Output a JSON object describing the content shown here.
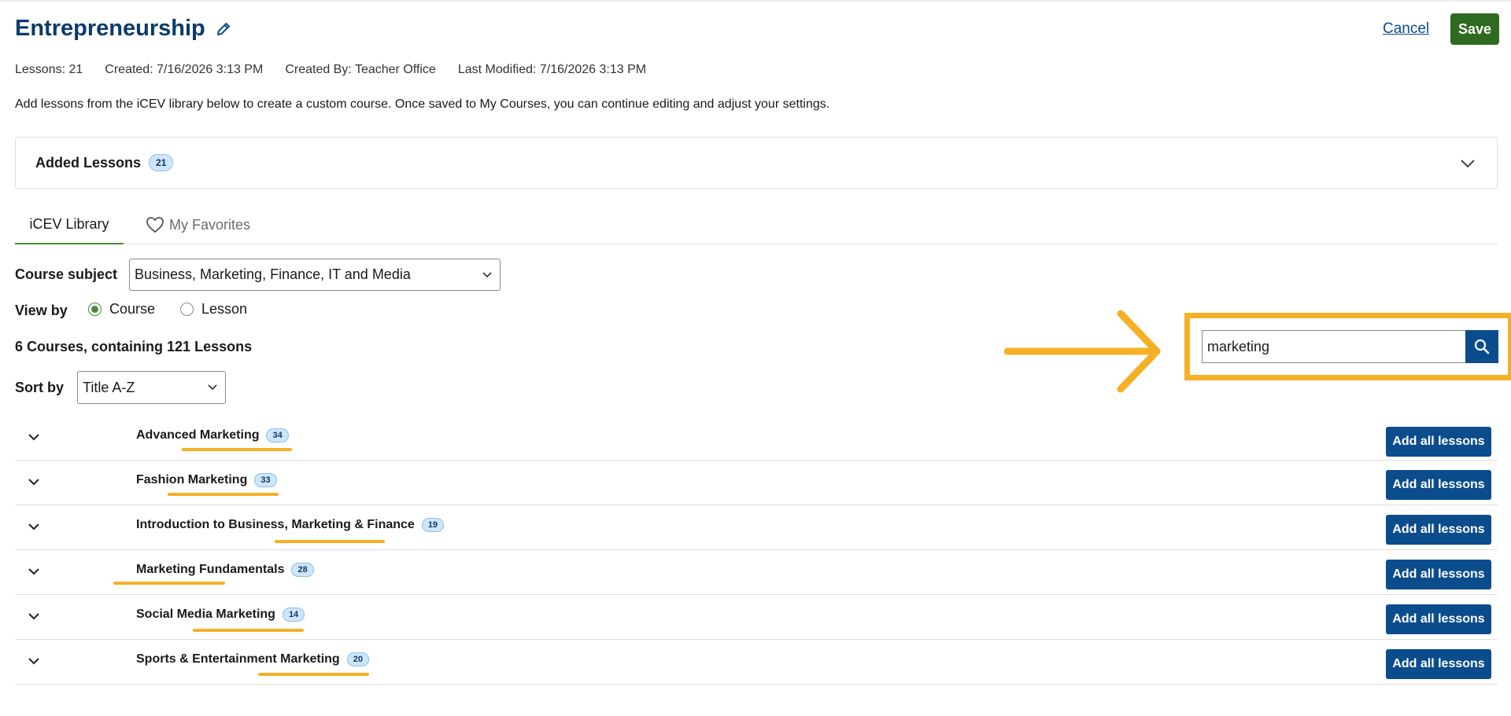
{
  "header": {
    "title": "Entrepreneurship",
    "cancel_label": "Cancel",
    "save_label": "Save"
  },
  "meta": {
    "lessons": "Lessons: 21",
    "created": "Created: 7/16/2026 3:13 PM",
    "created_by": "Created By: Teacher Office",
    "last_modified": "Last Modified: 7/16/2026 3:13 PM"
  },
  "description": "Add lessons from the iCEV library below to create a custom course. Once saved to My Courses, you can continue editing and adjust your settings.",
  "added_lessons": {
    "label": "Added Lessons",
    "count": "21"
  },
  "tabs": [
    {
      "label": "iCEV Library",
      "active": true
    },
    {
      "label": "My Favorites",
      "icon": "heart-icon"
    }
  ],
  "filters": {
    "course_subject_label": "Course subject",
    "course_subject_value": "Business, Marketing, Finance, IT and Media",
    "view_by_label": "View by",
    "view_options": [
      "Course",
      "Lesson"
    ],
    "view_selected": "Course",
    "sort_by_label": "Sort by",
    "sort_value": "Title A-Z"
  },
  "results_summary": "6 Courses, containing 121 Lessons",
  "search": {
    "value": "marketing",
    "icon": "search-icon"
  },
  "courses": [
    {
      "name": "Advanced Marketing",
      "count": "34",
      "action": "Add all lessons"
    },
    {
      "name": "Fashion Marketing",
      "count": "33",
      "action": "Add all lessons"
    },
    {
      "name": "Introduction to Business, Marketing & Finance",
      "count": "19",
      "action": "Add all lessons"
    },
    {
      "name": "Marketing Fundamentals",
      "count": "28",
      "action": "Add all lessons"
    },
    {
      "name": "Social Media Marketing",
      "count": "14",
      "action": "Add all lessons"
    },
    {
      "name": "Sports & Entertainment Marketing",
      "count": "20",
      "action": "Add all lessons"
    }
  ],
  "colors": {
    "title_blue": "#0b3a6b",
    "primary_button": "#0b4c8c",
    "save_green": "#2e6a1f",
    "highlight_orange": "#f6b026",
    "badge_bg": "#cfe5fa"
  }
}
